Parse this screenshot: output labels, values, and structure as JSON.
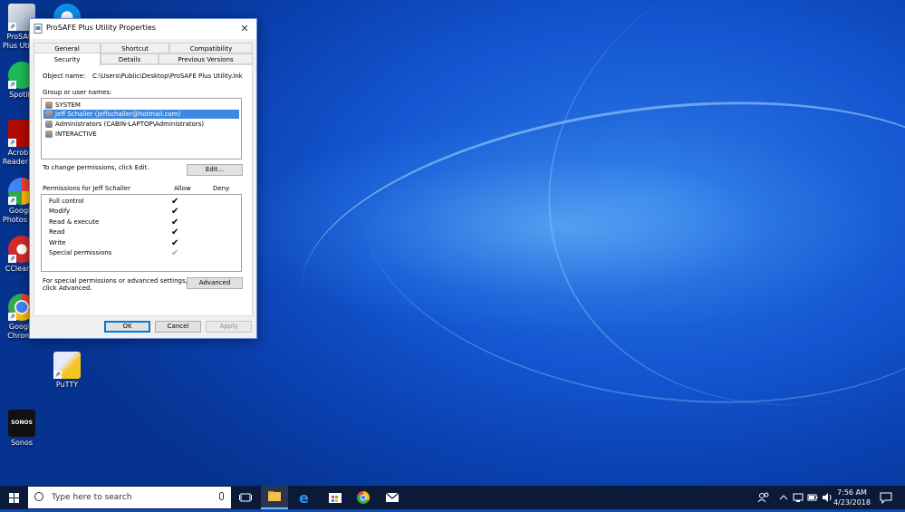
{
  "desktop": {
    "icons": [
      {
        "label": "ProSAFE Plus Utility",
        "name": "prosafe-desktop-icon"
      },
      {
        "label": "Spotify",
        "name": "spotify-desktop-icon"
      },
      {
        "label": "Acrobat Reader DC",
        "name": "acrobat-desktop-icon"
      },
      {
        "label": "Google Photos Pro",
        "name": "google-photos-desktop-icon"
      },
      {
        "label": "CCleaner",
        "name": "ccleaner-desktop-icon"
      },
      {
        "label": "Google Chrome",
        "name": "chrome-desktop-icon"
      },
      {
        "label": "PuTTY",
        "name": "putty-desktop-icon"
      },
      {
        "label": "Sonos",
        "name": "sonos-desktop-icon"
      }
    ]
  },
  "dialog": {
    "title": "ProSAFE Plus Utility Properties",
    "close_label": "✕",
    "tabs_row1": [
      "General",
      "Shortcut",
      "Compatibility"
    ],
    "tabs_row2": [
      "Security",
      "Details",
      "Previous Versions"
    ],
    "active_tab": "Security",
    "object_name_label": "Object name:",
    "object_name_value": "C:\\Users\\Public\\Desktop\\ProSAFE Plus Utility.lnk",
    "group_label": "Group or user names:",
    "users": [
      "SYSTEM",
      "Jeff Schaller (jeffschaller@hotmail.com)",
      "Administrators (CABIN-LAPTOP\\Administrators)",
      "INTERACTIVE"
    ],
    "selected_user_index": 1,
    "change_text": "To change permissions, click Edit.",
    "edit_button": "Edit...",
    "permissions_for": "Permissions for Jeff Schaller",
    "allow_header": "Allow",
    "deny_header": "Deny",
    "permissions": [
      {
        "name": "Full control",
        "allow": "✔",
        "greyed": false
      },
      {
        "name": "Modify",
        "allow": "✔",
        "greyed": false
      },
      {
        "name": "Read & execute",
        "allow": "✔",
        "greyed": false
      },
      {
        "name": "Read",
        "allow": "✔",
        "greyed": false
      },
      {
        "name": "Write",
        "allow": "✔",
        "greyed": false
      },
      {
        "name": "Special permissions",
        "allow": "✔",
        "greyed": true
      }
    ],
    "special_text_1": "For special permissions or advanced settings,",
    "special_text_2": "click Advanced.",
    "advanced_button": "Advanced",
    "ok_button": "OK",
    "cancel_button": "Cancel",
    "apply_button": "Apply"
  },
  "taskbar": {
    "search_placeholder": "Type here to search",
    "time": "7:56 AM",
    "date": "4/23/2018"
  },
  "colors": {
    "selection": "#3d88e0",
    "taskbar": "#0c1a3a",
    "accent": "#0078d7"
  }
}
